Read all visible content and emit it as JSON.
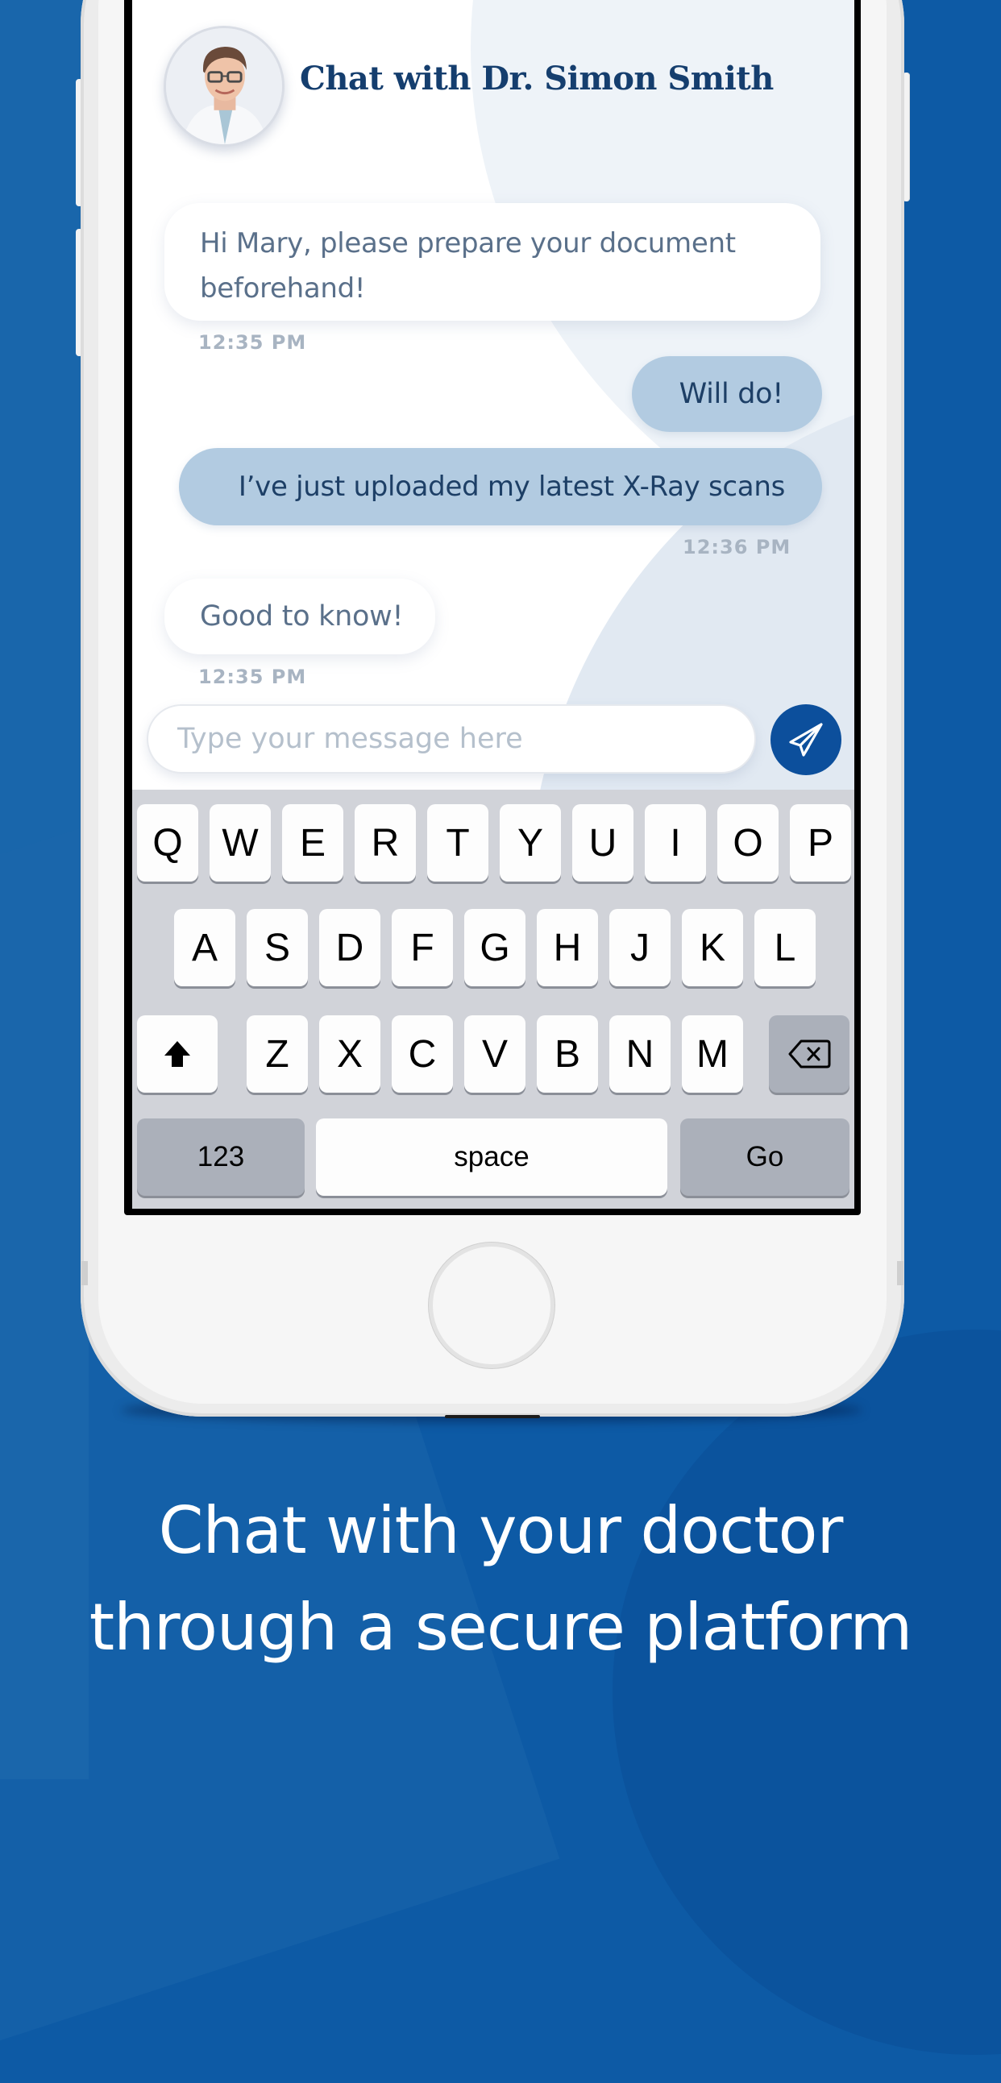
{
  "colors": {
    "background_blue": "#0d5aa5",
    "accent_navy": "#153e6e",
    "send_button": "#0c4f9c",
    "outgoing_bubble": "#b2cbe1",
    "incoming_bubble": "#ffffff"
  },
  "chat": {
    "title": "Chat with Dr. Simon Smith",
    "avatar_icon": "doctor-portrait",
    "messages": [
      {
        "direction": "incoming",
        "text": "Hi Mary, please prepare your document beforehand!",
        "time": "12:35 PM"
      },
      {
        "direction": "outgoing",
        "text": "Will do!",
        "time": ""
      },
      {
        "direction": "outgoing",
        "text": "I’ve just uploaded my latest X-Ray scans",
        "time": "12:36 PM"
      },
      {
        "direction": "incoming",
        "text": "Good to know!",
        "time": "12:35 PM"
      }
    ],
    "composer": {
      "placeholder": "Type your message here",
      "value": "",
      "send_icon": "paper-plane-icon"
    }
  },
  "keyboard": {
    "row1": [
      "Q",
      "W",
      "E",
      "R",
      "T",
      "Y",
      "U",
      "I",
      "O",
      "P"
    ],
    "row2": [
      "A",
      "S",
      "D",
      "F",
      "G",
      "H",
      "J",
      "K",
      "L"
    ],
    "row3": [
      "Z",
      "X",
      "C",
      "V",
      "B",
      "N",
      "M"
    ],
    "shift_icon": "shift-arrow-icon",
    "delete_icon": "backspace-icon",
    "numbers_label": "123",
    "space_label": "space",
    "go_label": "Go"
  },
  "caption": {
    "line1": "Chat with your doctor",
    "line2": "through a secure platform"
  }
}
